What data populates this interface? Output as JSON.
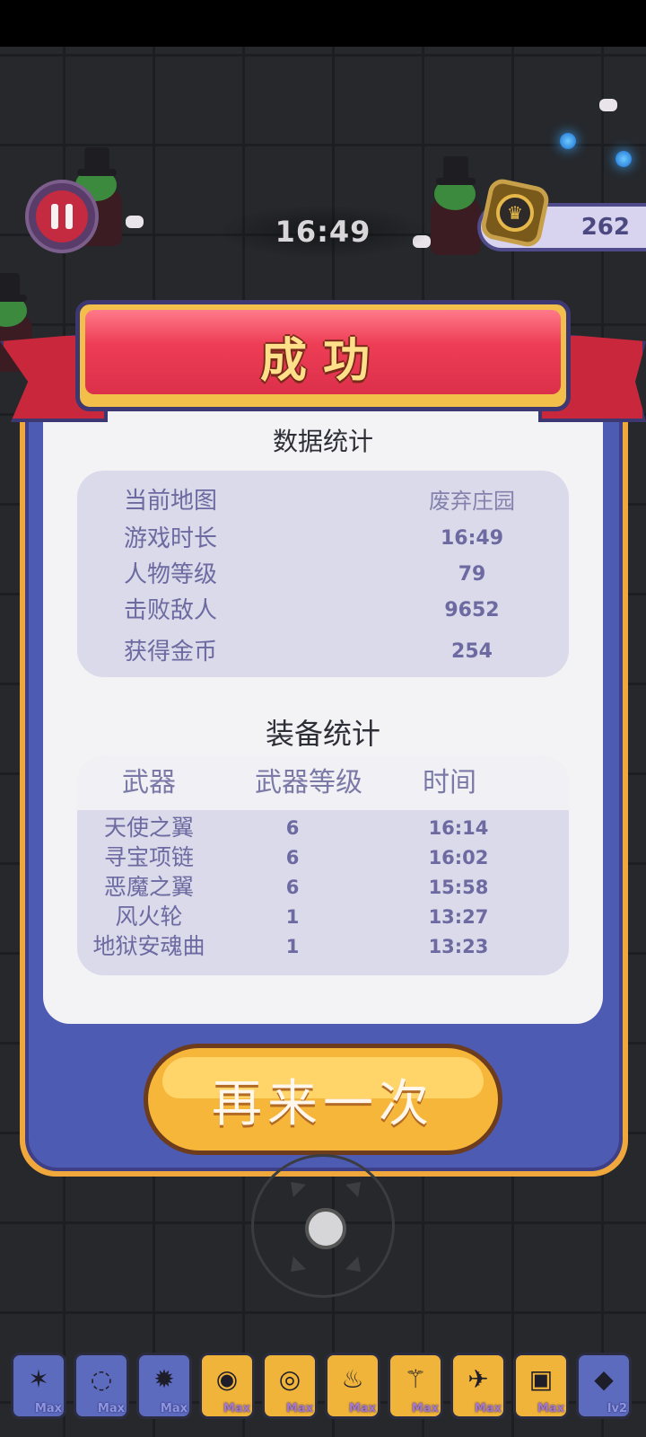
{
  "hud": {
    "timer": "16:49",
    "coins": "262"
  },
  "dialog": {
    "title": "成功",
    "stats_title": "数据统计",
    "stats": [
      {
        "label": "当前地图",
        "value": "废弃庄园"
      },
      {
        "label": "游戏时长",
        "value": "16:49"
      },
      {
        "label": "人物等级",
        "value": "79"
      },
      {
        "label": "击败敌人",
        "value": "9652"
      },
      {
        "label": "获得金币",
        "value": "254"
      }
    ],
    "equip_title": "装备统计",
    "equip_headers": [
      "武器",
      "武器等级",
      "时间"
    ],
    "equipment": [
      {
        "name": "天使之翼",
        "level": "6",
        "time": "16:14"
      },
      {
        "name": "寻宝项链",
        "level": "6",
        "time": "16:02"
      },
      {
        "name": "恶魔之翼",
        "level": "6",
        "time": "15:58"
      },
      {
        "name": "风火轮",
        "level": "1",
        "time": "13:27"
      },
      {
        "name": "地狱安魂曲",
        "level": "1",
        "time": "13:23"
      }
    ],
    "retry_label": "再来一次"
  },
  "items": [
    {
      "icon": "wings-icon",
      "glyph": "✶",
      "tag": "Max",
      "style": "blue"
    },
    {
      "icon": "necklace-icon",
      "glyph": "◌",
      "tag": "Max",
      "style": "blue"
    },
    {
      "icon": "demon-wings-icon",
      "glyph": "✹",
      "tag": "Max",
      "style": "blue"
    },
    {
      "icon": "fire-wheel-icon",
      "glyph": "◉",
      "tag": "Max",
      "style": "gold"
    },
    {
      "icon": "ring-icon",
      "glyph": "◎",
      "tag": "Max",
      "style": "gold"
    },
    {
      "icon": "torch-icon",
      "glyph": "♨",
      "tag": "Max",
      "style": "gold"
    },
    {
      "icon": "staff-icon",
      "glyph": "⚚",
      "tag": "Max",
      "style": "gold"
    },
    {
      "icon": "blaster-icon",
      "glyph": "✈",
      "tag": "Max",
      "style": "gold"
    },
    {
      "icon": "block-icon",
      "glyph": "▣",
      "tag": "Max",
      "style": "gold"
    },
    {
      "icon": "diamond-icon",
      "glyph": "◆",
      "tag": "lv2",
      "style": "blue"
    }
  ],
  "colors": {
    "panel_frame": "#f0a83c",
    "panel_border": "#4d5bb3",
    "ribbon": "#dc2f4a",
    "retry_button": "#f6b63a",
    "stat_text": "#6c6aa0"
  }
}
